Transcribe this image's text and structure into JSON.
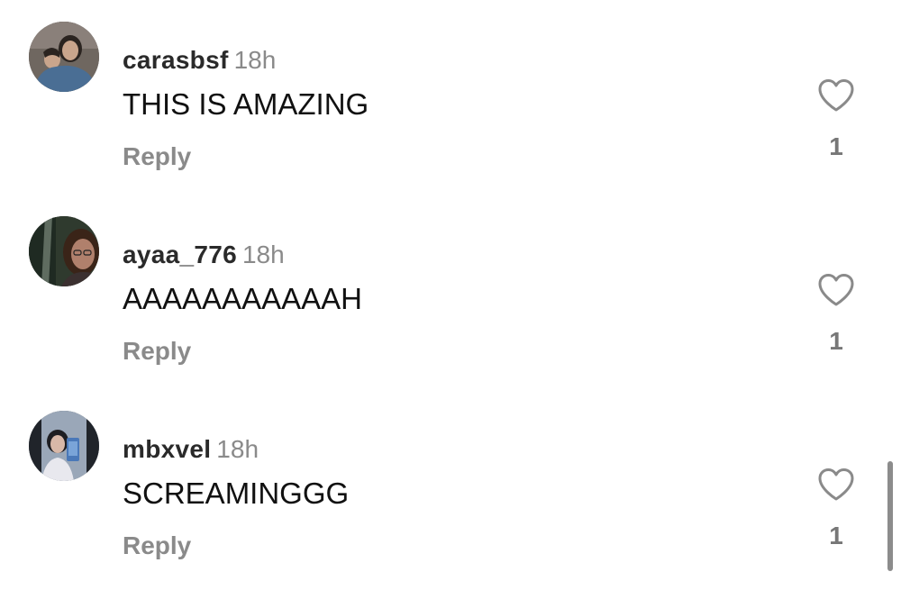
{
  "comments": [
    {
      "username": "carasbsf",
      "time": "18h",
      "text": "THIS IS AMAZING",
      "reply_label": "Reply",
      "likes": "1",
      "avatar_colors": {
        "bg": "#6f6760",
        "face": "#c9a58c",
        "shirt": "#4a6e94",
        "hair": "#2b2420"
      }
    },
    {
      "username": "ayaa_776",
      "time": "18h",
      "text": "AAAAAAAAAAAH",
      "reply_label": "Reply",
      "likes": "1",
      "avatar_colors": {
        "bg": "#2f3a2e",
        "face": "#b0806c",
        "shirt": "#3b3030",
        "hair": "#3a2418"
      }
    },
    {
      "username": "mbxvel",
      "time": "18h",
      "text": "SCREAMINGGG",
      "reply_label": "Reply",
      "likes": "1",
      "avatar_colors": {
        "bg": "#9aa7b8",
        "face": "#d8b8a8",
        "shirt": "#e8e8ee",
        "hair": "#1e1e22"
      }
    }
  ],
  "icons": {
    "like": "heart-outline-icon"
  },
  "colors": {
    "username": "#2a2a2a",
    "muted": "#8a8a8a",
    "text": "#111111",
    "heart_stroke": "#8a8a8a",
    "scrollbar": "#8c8c8c"
  }
}
